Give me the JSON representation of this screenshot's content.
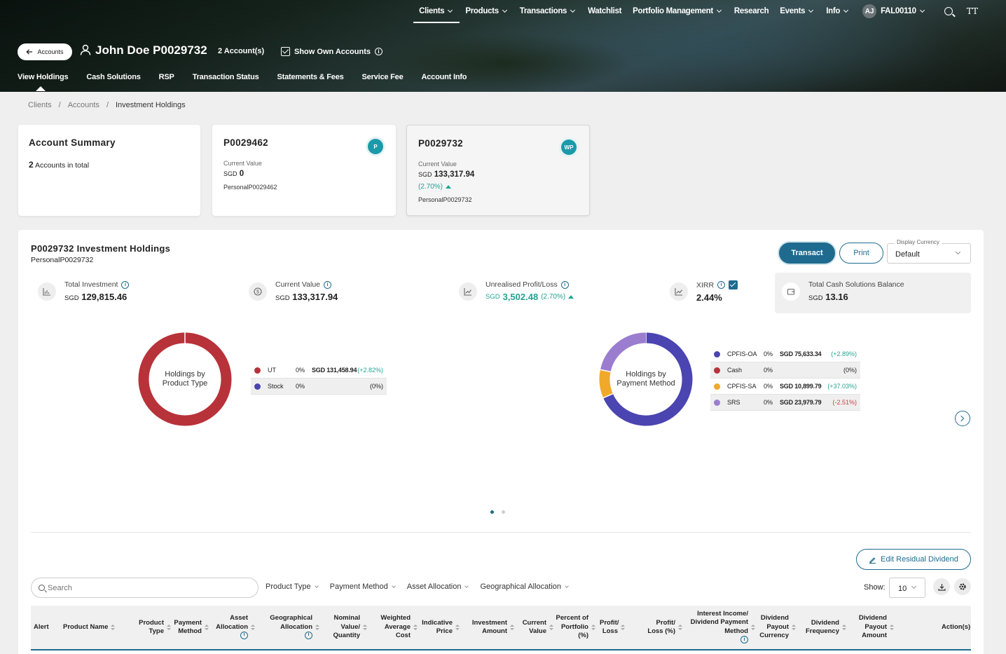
{
  "topnav": {
    "items": [
      "Clients",
      "Products",
      "Transactions",
      "Watchlist",
      "Portfolio Management",
      "Research",
      "Events",
      "Info"
    ],
    "has_dropdown": [
      true,
      true,
      true,
      false,
      true,
      false,
      true,
      true
    ],
    "active": "Clients",
    "avatar_initials": "AJ",
    "user_id": "FAL00110",
    "font_size_icon": "TT"
  },
  "header": {
    "back_label": "Accounts",
    "client_name": "John Doe P0029732",
    "account_count": "2 Account(s)",
    "show_own_accounts": "Show Own Accounts",
    "show_own_checked": true
  },
  "subnav": {
    "items": [
      "View Holdings",
      "Cash Solutions",
      "RSP",
      "Transaction Status",
      "Statements & Fees",
      "Service Fee",
      "Account Info"
    ],
    "active": "View Holdings"
  },
  "breadcrumb": [
    "Clients",
    "Accounts",
    "Investment Holdings"
  ],
  "summary": {
    "title": "Account Summary",
    "count": "2",
    "count_suffix": "Accounts in total"
  },
  "accounts": [
    {
      "id": "P0029462",
      "badge": "P",
      "value_label": "Current Value",
      "currency": "SGD",
      "value": "0",
      "change": "",
      "sub": "PersonalP0029462"
    },
    {
      "id": "P0029732",
      "badge": "WP",
      "value_label": "Current Value",
      "currency": "SGD",
      "value": "133,317.94",
      "change": "(2.70%)",
      "sub": "PersonalP0029732"
    }
  ],
  "holdings": {
    "title": "P0029732 Investment Holdings",
    "subtitle": "PersonalP0029732",
    "transact_label": "Transact",
    "print_label": "Print",
    "display_currency_label": "Display Currency",
    "display_currency_value": "Default",
    "metrics": {
      "total_investment": {
        "label": "Total Investment",
        "currency": "SGD",
        "value": "129,815.46"
      },
      "current_value": {
        "label": "Current Value",
        "currency": "SGD",
        "value": "133,317.94"
      },
      "unrealised": {
        "label": "Unrealised Profit/Loss",
        "currency": "SGD",
        "value": "3,502.48",
        "pct": "(2.70%)"
      },
      "xirr": {
        "label": "XIRR",
        "value": "2.44%",
        "checked": true
      },
      "cash_balance": {
        "label": "Total Cash Solutions Balance",
        "currency": "SGD",
        "value": "13.16"
      }
    }
  },
  "chart_data": [
    {
      "type": "pie",
      "title": "Holdings by Product Type",
      "series": [
        {
          "name": "UT",
          "pct": "0%",
          "amount": "SGD 131,458.94",
          "change": "(+2.82%)",
          "color": "#b8323a",
          "share": 1.0
        },
        {
          "name": "Stock",
          "pct": "0%",
          "amount": "",
          "change": "(0%)",
          "color": "#4a45b0",
          "share": 0.0
        }
      ]
    },
    {
      "type": "pie",
      "title": "Holdings by Payment Method",
      "series": [
        {
          "name": "CPFIS-OA",
          "pct": "0%",
          "amount": "SGD 75,633.34",
          "change": "(+2.89%)",
          "color": "#4a45b0",
          "share": 0.5673
        },
        {
          "name": "Cash",
          "pct": "0%",
          "amount": "",
          "change": "(0%)",
          "color": "#b8323a",
          "share": 0.0
        },
        {
          "name": "CPFIS-SA",
          "pct": "0%",
          "amount": "SGD 10,899.79",
          "change": "(+37.03%)",
          "color": "#f0a92a",
          "share": 0.0818
        },
        {
          "name": "SRS",
          "pct": "0%",
          "amount": "SGD 23,979.79",
          "change": "(-2.51%)",
          "color": "#9b7dd0",
          "share": 0.1799
        }
      ]
    }
  ],
  "table": {
    "edit_residual_label": "Edit Residual Dividend",
    "search_placeholder": "Search",
    "filters": [
      "Product Type",
      "Payment Method",
      "Asset Allocation",
      "Geographical Allocation"
    ],
    "show_label": "Show:",
    "show_value": "10",
    "columns": [
      "Alert",
      "Product Name",
      "Product Type",
      "Payment Method",
      "Asset Allocation",
      "Geographical Allocation",
      "Nominal Value/ Quantity",
      "Weighted Average Cost",
      "Indicative Price",
      "Investment Amount",
      "Current Value",
      "Percent of Portfolio (%)",
      "Profit/ Loss",
      "Profit/ Loss (%)",
      "Interest Income/ Dividend Payment Method",
      "Dividend Payout Currency",
      "Dividend Frequency",
      "Dividend Payout Amount",
      "Action(s)"
    ]
  },
  "colors": {
    "primary": "#1e6b8f",
    "positive": "#21a392",
    "negative": "#d23d3d",
    "badge": "#1b9aaa"
  }
}
